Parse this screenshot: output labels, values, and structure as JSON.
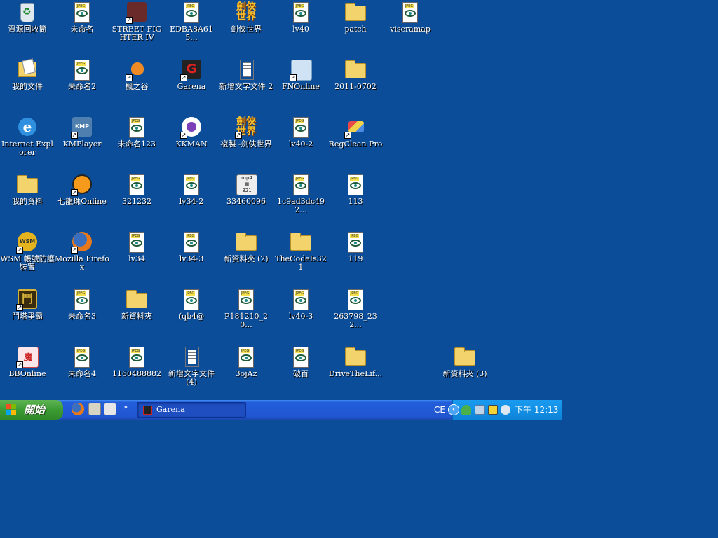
{
  "desktop": {
    "icons": [
      {
        "label": "資源回收筒",
        "icon": "recycle-bin-icon"
      },
      {
        "label": "未命名",
        "icon": "xnview-image-icon"
      },
      {
        "label": "STREET FIGHTER IV",
        "icon": "street-fighter-icon"
      },
      {
        "label": "EDBA8A615...",
        "icon": "xnview-image-icon"
      },
      {
        "label": "劍俠世界",
        "icon": "jianxia-game-icon"
      },
      {
        "label": "lv40",
        "icon": "xnview-image-icon"
      },
      {
        "label": "patch",
        "icon": "folder-icon"
      },
      {
        "label": "viseramap",
        "icon": "xnview-image-icon"
      },
      {
        "label": "我的文件",
        "icon": "my-documents-icon"
      },
      {
        "label": "未命名2",
        "icon": "xnview-image-icon"
      },
      {
        "label": "楓之谷",
        "icon": "maplestory-icon"
      },
      {
        "label": "Garena",
        "icon": "garena-icon"
      },
      {
        "label": "新增文字文件 2",
        "icon": "text-document-icon"
      },
      {
        "label": "FNOnline",
        "icon": "fnonline-icon"
      },
      {
        "label": "2011-0702",
        "icon": "folder-icon"
      },
      {
        "label": "Internet Explorer",
        "icon": "internet-explorer-icon"
      },
      {
        "label": "KMPlayer",
        "icon": "kmplayer-icon"
      },
      {
        "label": "未命名123",
        "icon": "xnview-image-icon"
      },
      {
        "label": "KKMAN",
        "icon": "kkman-icon"
      },
      {
        "label": "複製 -劍俠世界",
        "icon": "jianxia-game-icon"
      },
      {
        "label": "lv40-2",
        "icon": "xnview-image-icon"
      },
      {
        "label": "RegClean Pro",
        "icon": "regclean-icon"
      },
      {
        "label": "我的資料",
        "icon": "folder-icon"
      },
      {
        "label": "七龍珠Online",
        "icon": "dragonball-online-icon"
      },
      {
        "label": "321232",
        "icon": "xnview-image-icon"
      },
      {
        "label": "lv34-2",
        "icon": "xnview-image-icon"
      },
      {
        "label": "33460096",
        "icon": "mp4-video-icon"
      },
      {
        "label": "1c9ad3dc492...",
        "icon": "xnview-image-icon"
      },
      {
        "label": "113",
        "icon": "xnview-image-icon"
      },
      {
        "label": "WSM 帳號防護裝置",
        "icon": "wsm-icon"
      },
      {
        "label": "Mozilla Firefox",
        "icon": "firefox-icon"
      },
      {
        "label": "lv34",
        "icon": "xnview-image-icon"
      },
      {
        "label": "lv34-3",
        "icon": "xnview-image-icon"
      },
      {
        "label": "新資料夾 (2)",
        "icon": "folder-icon"
      },
      {
        "label": "TheCodeIs321",
        "icon": "folder-icon"
      },
      {
        "label": "119",
        "icon": "xnview-image-icon"
      },
      {
        "label": "鬥塔爭霸",
        "icon": "doutazhengba-icon"
      },
      {
        "label": "未命名3",
        "icon": "xnview-image-icon"
      },
      {
        "label": "新資料夾",
        "icon": "folder-icon"
      },
      {
        "label": "(qb4@",
        "icon": "xnview-image-icon"
      },
      {
        "label": "P181210_20...",
        "icon": "xnview-image-icon"
      },
      {
        "label": "lv40-3",
        "icon": "xnview-image-icon"
      },
      {
        "label": "263798_232...",
        "icon": "xnview-image-icon"
      },
      {
        "label": "BBOnline",
        "icon": "bbonline-icon"
      },
      {
        "label": "未命名4",
        "icon": "xnview-image-icon"
      },
      {
        "label": "1160488882",
        "icon": "xnview-image-icon"
      },
      {
        "label": "新增文字文件 (4)",
        "icon": "text-document-icon"
      },
      {
        "label": "3ojAz",
        "icon": "xnview-image-icon"
      },
      {
        "label": "破百",
        "icon": "xnview-image-icon"
      },
      {
        "label": "DriveTheLif...",
        "icon": "folder-icon"
      },
      {
        "label": "新資料夾 (3)",
        "icon": "folder-icon"
      }
    ]
  },
  "taskbar": {
    "start_label": "開始",
    "quick_launch": [
      "firefox-icon",
      "show-desktop-icon",
      "quick-launch-app-icon"
    ],
    "overflow_label": "»",
    "tasks": [
      {
        "label": "Garena",
        "icon": "garena-icon"
      }
    ],
    "language_indicator": "CE",
    "tray_icons": [
      "network-user-icon",
      "network-connections-icon",
      "security-alert-icon",
      "volume-icon"
    ],
    "clock": "下午 12:13"
  },
  "colors": {
    "desktop": "#0b4d98",
    "taskbar": "#245edb",
    "start_button": "#3c9b34",
    "tray": "#1290e6"
  }
}
